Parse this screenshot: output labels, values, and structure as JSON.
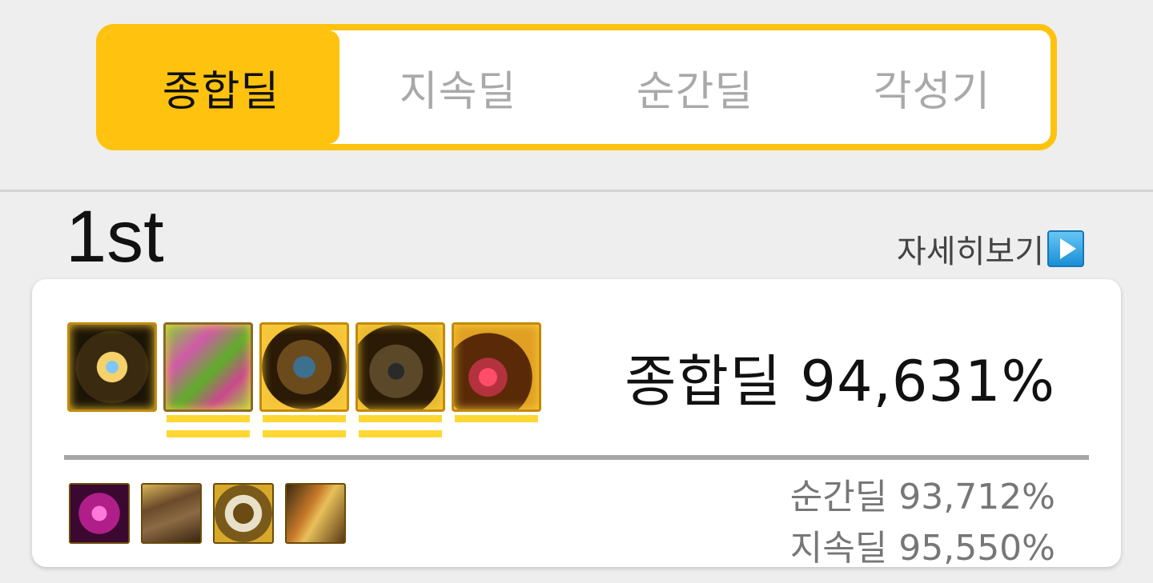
{
  "tabs": [
    {
      "label": "종합딜",
      "active": true
    },
    {
      "label": "지속딜",
      "active": false
    },
    {
      "label": "순간딜",
      "active": false
    },
    {
      "label": "각성기",
      "active": false
    }
  ],
  "result": {
    "rank": "1st",
    "detail_link": "자세히보기",
    "total_label": "종합딜 94,631%",
    "burst_label": "순간딜 93,712%",
    "sustain_label": "지속딜 95,550%"
  },
  "equipment_icons": [
    "weapon-icon",
    "top-armor-icon",
    "bracelet-icon",
    "star-ring-icon",
    "necklace-icon"
  ],
  "equipment_underlines": [
    0,
    2,
    2,
    2,
    1
  ],
  "sub_icons": [
    "magic-stone-icon",
    "pants-icon",
    "ring-icon",
    "belt-icon"
  ],
  "colors": {
    "accent": "#ffc20e",
    "underline": "#ffd733"
  }
}
